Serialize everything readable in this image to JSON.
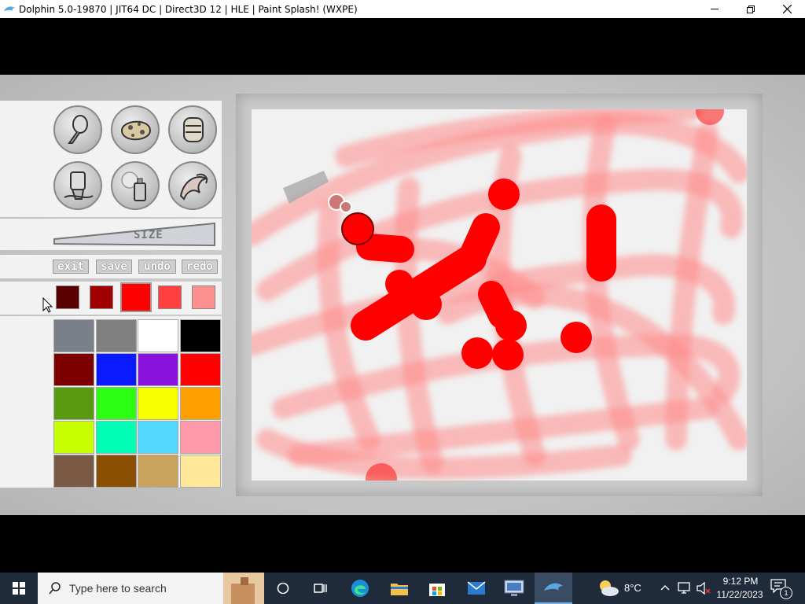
{
  "window": {
    "title": "Dolphin 5.0-19870 | JIT64 DC | Direct3D 12 | HLE | Paint Splash! (WXPE)"
  },
  "window_controls": [
    "minimize-icon",
    "restore-icon",
    "close-icon"
  ],
  "game": {
    "tools": [
      "pencil-brush-tool",
      "sponge-tool",
      "roller-tool",
      "paint-tube-tool",
      "spray-can-tool",
      "splash-tool"
    ],
    "size_label": "SIZE",
    "actions": {
      "exit": "exit",
      "save": "save",
      "undo": "undo",
      "redo": "redo"
    },
    "selected_color": "#ff0000",
    "shades": [
      "#5a0000",
      "#a10000",
      "#ff0000",
      "#ff4040",
      "#ff9090"
    ],
    "palette": [
      [
        "#7a7f8a",
        "#808080",
        "#ffffff",
        "#000000"
      ],
      [
        "#7d0000",
        "#0a1aff",
        "#8a12dd",
        "#ff0000"
      ],
      [
        "#5a9a10",
        "#2cff14",
        "#f7ff00",
        "#ff9f00"
      ],
      [
        "#c8ff00",
        "#00ffb4",
        "#52d8ff",
        "#ff9aaa"
      ],
      [
        "#7a5a45",
        "#8a4f00",
        "#c9a25e",
        "#ffe89a"
      ]
    ]
  },
  "taskbar": {
    "search_placeholder": "Type here to search",
    "weather": "8°C",
    "time": "9:12 PM",
    "date": "11/22/2023",
    "notification_count": "1",
    "apps": [
      "cortana-icon",
      "task-view-icon",
      "edge-icon",
      "file-explorer-icon",
      "store-icon",
      "mail-icon",
      "remote-desktop-icon",
      "dolphin-icon"
    ]
  }
}
